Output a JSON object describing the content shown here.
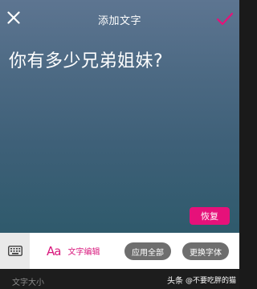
{
  "header": {
    "title": "添加文字",
    "close_icon": "close-icon",
    "confirm_icon": "check-icon",
    "accent_color": "#e6117a"
  },
  "canvas": {
    "text": "你有多少兄弟姐妹?",
    "restore_label": "恢复"
  },
  "toolbar": {
    "keyboard_icon": "keyboard-icon",
    "text_edit_icon": "Aa",
    "text_edit_label": "文字编辑",
    "apply_all_label": "应用全部",
    "change_font_label": "更换字体"
  },
  "footer": {
    "size_label": "文字大小",
    "watermark_brand": "头条",
    "watermark_user": "@不要吃胖的猫"
  }
}
